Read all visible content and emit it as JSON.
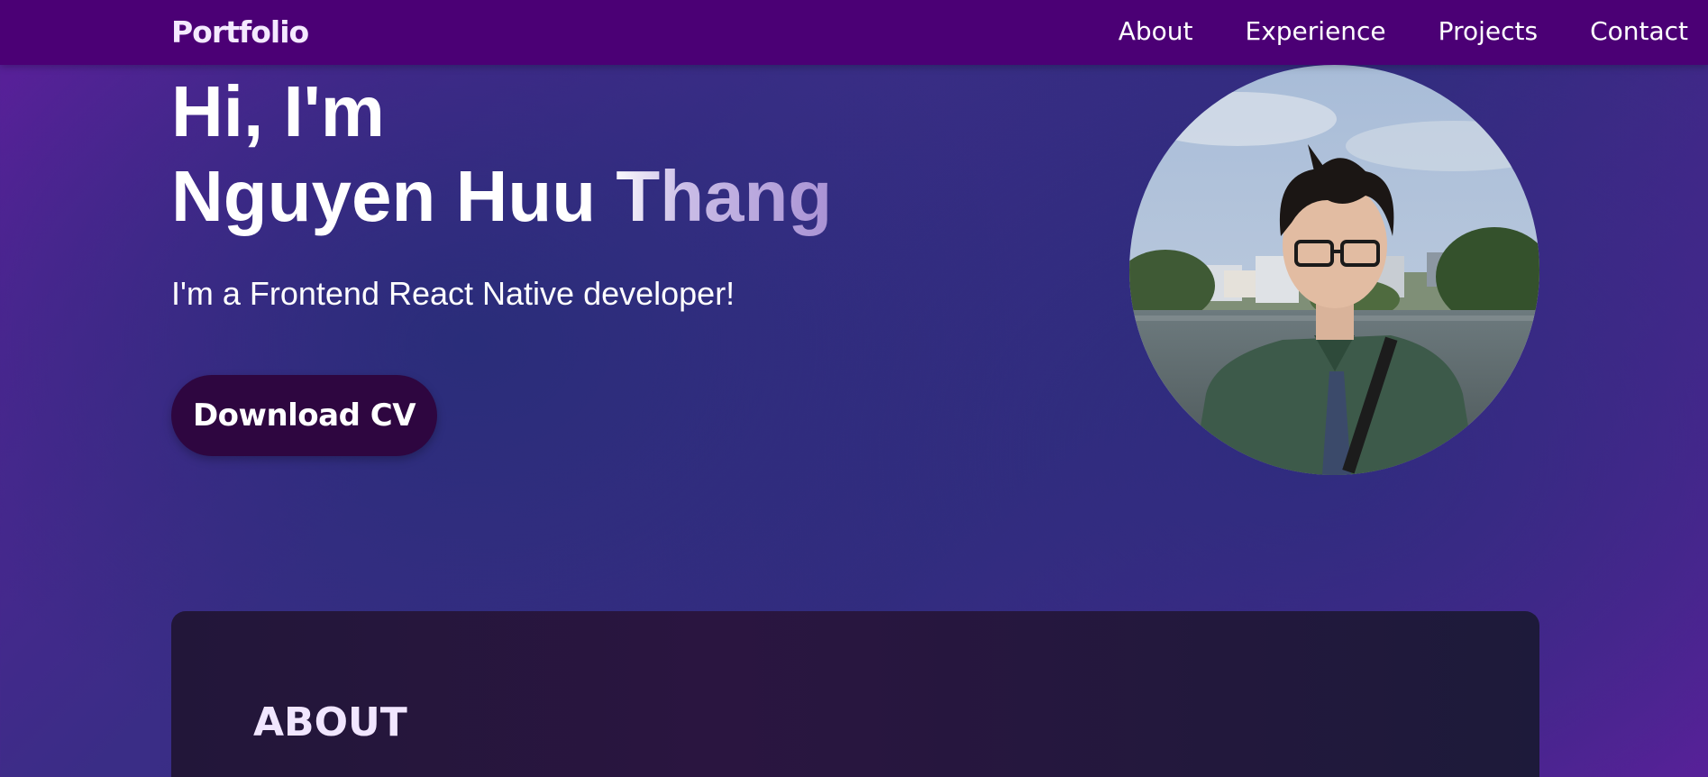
{
  "nav": {
    "brand": "Portfolio",
    "links": [
      "About",
      "Experience",
      "Projects",
      "Contact"
    ]
  },
  "hero": {
    "greeting": "Hi, I'm",
    "name": "Nguyen Huu Thang",
    "tagline": "I'm a Frontend React Native developer!",
    "cv_button": "Download CV"
  },
  "about": {
    "heading": "ABOUT"
  },
  "colors": {
    "navbar": "#4b0075",
    "button": "#2e0640",
    "card": "#221639"
  }
}
